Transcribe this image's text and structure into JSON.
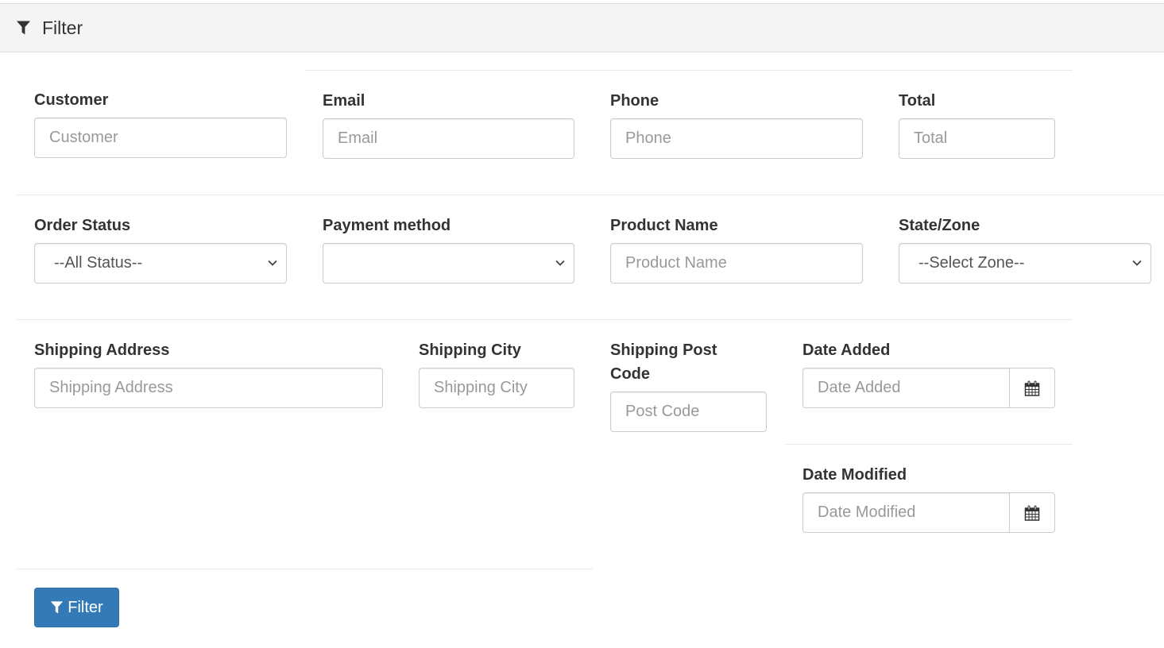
{
  "panel": {
    "title": "Filter",
    "icon": "filter-funnel-icon"
  },
  "fields": {
    "customer": {
      "label": "Customer",
      "placeholder": "Customer",
      "value": ""
    },
    "email": {
      "label": "Email",
      "placeholder": "Email",
      "value": ""
    },
    "phone": {
      "label": "Phone",
      "placeholder": "Phone",
      "value": ""
    },
    "total": {
      "label": "Total",
      "placeholder": "Total",
      "value": ""
    },
    "order_status": {
      "label": "Order Status",
      "selected": "--All Status--"
    },
    "payment_method": {
      "label": "Payment method",
      "selected": ""
    },
    "product_name": {
      "label": "Product Name",
      "placeholder": "Product Name",
      "value": ""
    },
    "state_zone": {
      "label": "State/Zone",
      "selected": "--Select Zone--"
    },
    "shipping_address": {
      "label": "Shipping Address",
      "placeholder": "Shipping Address",
      "value": ""
    },
    "shipping_city": {
      "label": "Shipping City",
      "placeholder": "Shipping City",
      "value": ""
    },
    "shipping_post_code": {
      "label_line1": "Shipping Post",
      "label_line2": "Code",
      "placeholder": "Post Code",
      "value": ""
    },
    "date_added": {
      "label": "Date Added",
      "placeholder": "Date Added",
      "value": "",
      "icon": "calendar-icon"
    },
    "date_modified": {
      "label": "Date Modified",
      "placeholder": "Date Modified",
      "value": "",
      "icon": "calendar-icon"
    }
  },
  "actions": {
    "filter_label": "Filter",
    "filter_icon": "filter-funnel-icon"
  },
  "colors": {
    "primary": "#337ab7",
    "heading_bg": "#f4f4f4",
    "border": "#cccccc"
  }
}
